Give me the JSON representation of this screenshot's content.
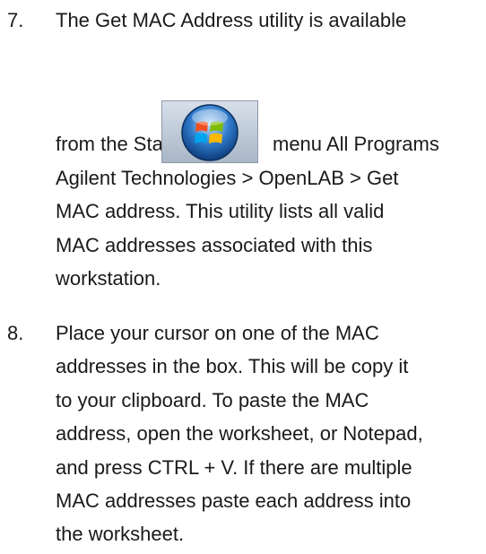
{
  "steps": [
    {
      "number": "7.",
      "lines": [
        "The Get MAC Address utility is available",
        "from the Start",
        "menu All Programs",
        "Agilent Technologies > OpenLAB > Get",
        "MAC address. This utility lists all valid",
        "MAC addresses associated with this",
        "workstation."
      ],
      "icon": "windows-start-orb-icon"
    },
    {
      "number": "8.",
      "lines": [
        "Place your cursor on one of the MAC",
        "addresses in the box.  This will be copy it",
        "to your clipboard.  To paste the MAC",
        "address, open the worksheet, or Notepad,",
        "and press CTRL + V. If there are multiple",
        "MAC addresses paste each address into",
        "the worksheet."
      ]
    }
  ]
}
